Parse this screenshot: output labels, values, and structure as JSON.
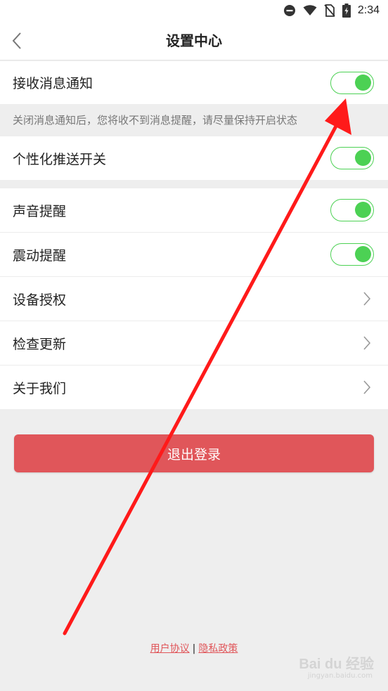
{
  "status_bar": {
    "time": "2:34"
  },
  "header": {
    "title": "设置中心"
  },
  "notification": {
    "label": "接收消息通知",
    "enabled": true,
    "hint": "关闭消息通知后，您将收不到消息提醒，请尽量保持开启状态"
  },
  "personalized_push": {
    "label": "个性化推送开关",
    "enabled": true
  },
  "sound": {
    "label": "声音提醒",
    "enabled": true
  },
  "vibration": {
    "label": "震动提醒",
    "enabled": true
  },
  "menu_items": [
    {
      "label": "设备授权"
    },
    {
      "label": "检查更新"
    },
    {
      "label": "关于我们"
    }
  ],
  "logout": {
    "label": "退出登录"
  },
  "footer": {
    "user_agreement": "用户协议",
    "separator": "|",
    "privacy_policy": "隐私政策"
  },
  "watermark": {
    "brand": "Bai du 经验",
    "sub": "jingyan.baidu.com"
  },
  "colors": {
    "accent_green": "#4cd154",
    "logout_red": "#e0565a",
    "arrow_red": "#ff1a1a"
  }
}
